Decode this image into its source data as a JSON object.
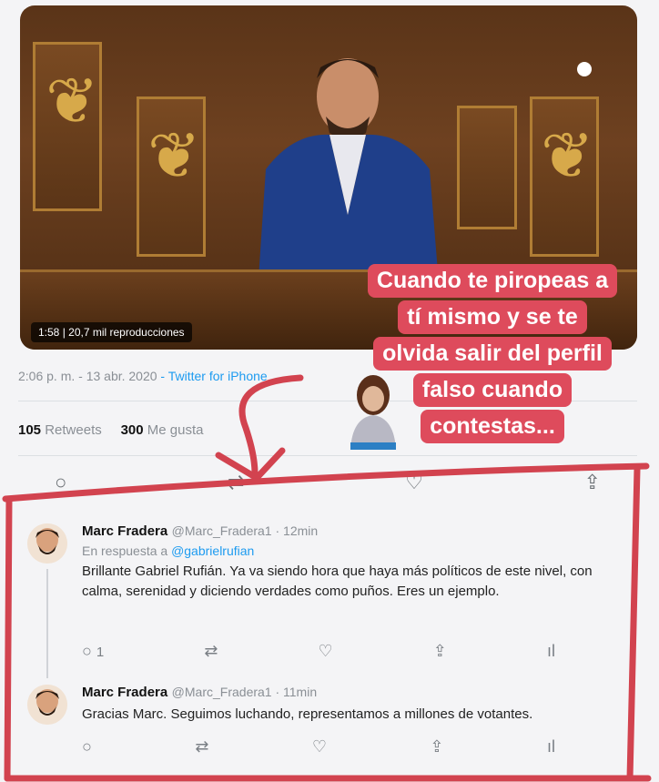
{
  "video": {
    "stats": "1:58 | 20,7 mil reproducciones"
  },
  "main_tweet": {
    "time": "2:06 p. m. - 13 abr. 2020",
    "via": " - Twitter for iPhone",
    "retweets_count": "105",
    "retweets_label": "Retweets",
    "likes_count": "300",
    "likes_label": "Me gusta"
  },
  "caption": {
    "lines": [
      "Cuando te piropeas a",
      "tí mismo y se te",
      "olvida salir del perfil",
      "falso cuando",
      "contestas..."
    ]
  },
  "replies": [
    {
      "name": "Marc Fradera",
      "handle": "@Marc_Fradera1 · 12min",
      "reply_prefix": "En respuesta a ",
      "reply_to": "@gabrielrufian",
      "text": "Brillante Gabriel Rufián. Ya va siendo hora que haya más políticos de este nivel, con calma, serenidad y diciendo verdades como puños. Eres un ejemplo.",
      "reply_count": "1"
    },
    {
      "name": "Marc Fradera",
      "handle": "@Marc_Fradera1 · 11min",
      "text": "Gracias Marc. Seguimos luchando, representamos a millones de votantes."
    }
  ],
  "icons": [
    "reply-icon",
    "retweet-icon",
    "like-icon",
    "share-icon",
    "analytics-icon"
  ],
  "colors": {
    "caption_bg": "#de4b5c",
    "link": "#1d9bf0",
    "annotation": "#d2434f"
  }
}
